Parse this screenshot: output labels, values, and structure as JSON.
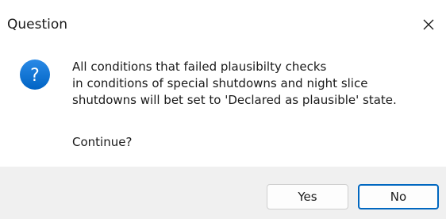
{
  "window": {
    "title": "Question",
    "close_icon": "close-icon"
  },
  "message": {
    "icon": "question-icon",
    "icon_color": "#0078d4",
    "lines": [
      "All conditions that failed plausibilty checks",
      "in conditions of special shutdowns and night slice",
      "shutdowns will bet set to 'Declared as plausible' state."
    ],
    "prompt": "Continue?"
  },
  "buttons": {
    "yes_label": "Yes",
    "no_label": "No",
    "default_button_border": "#0067c0"
  }
}
